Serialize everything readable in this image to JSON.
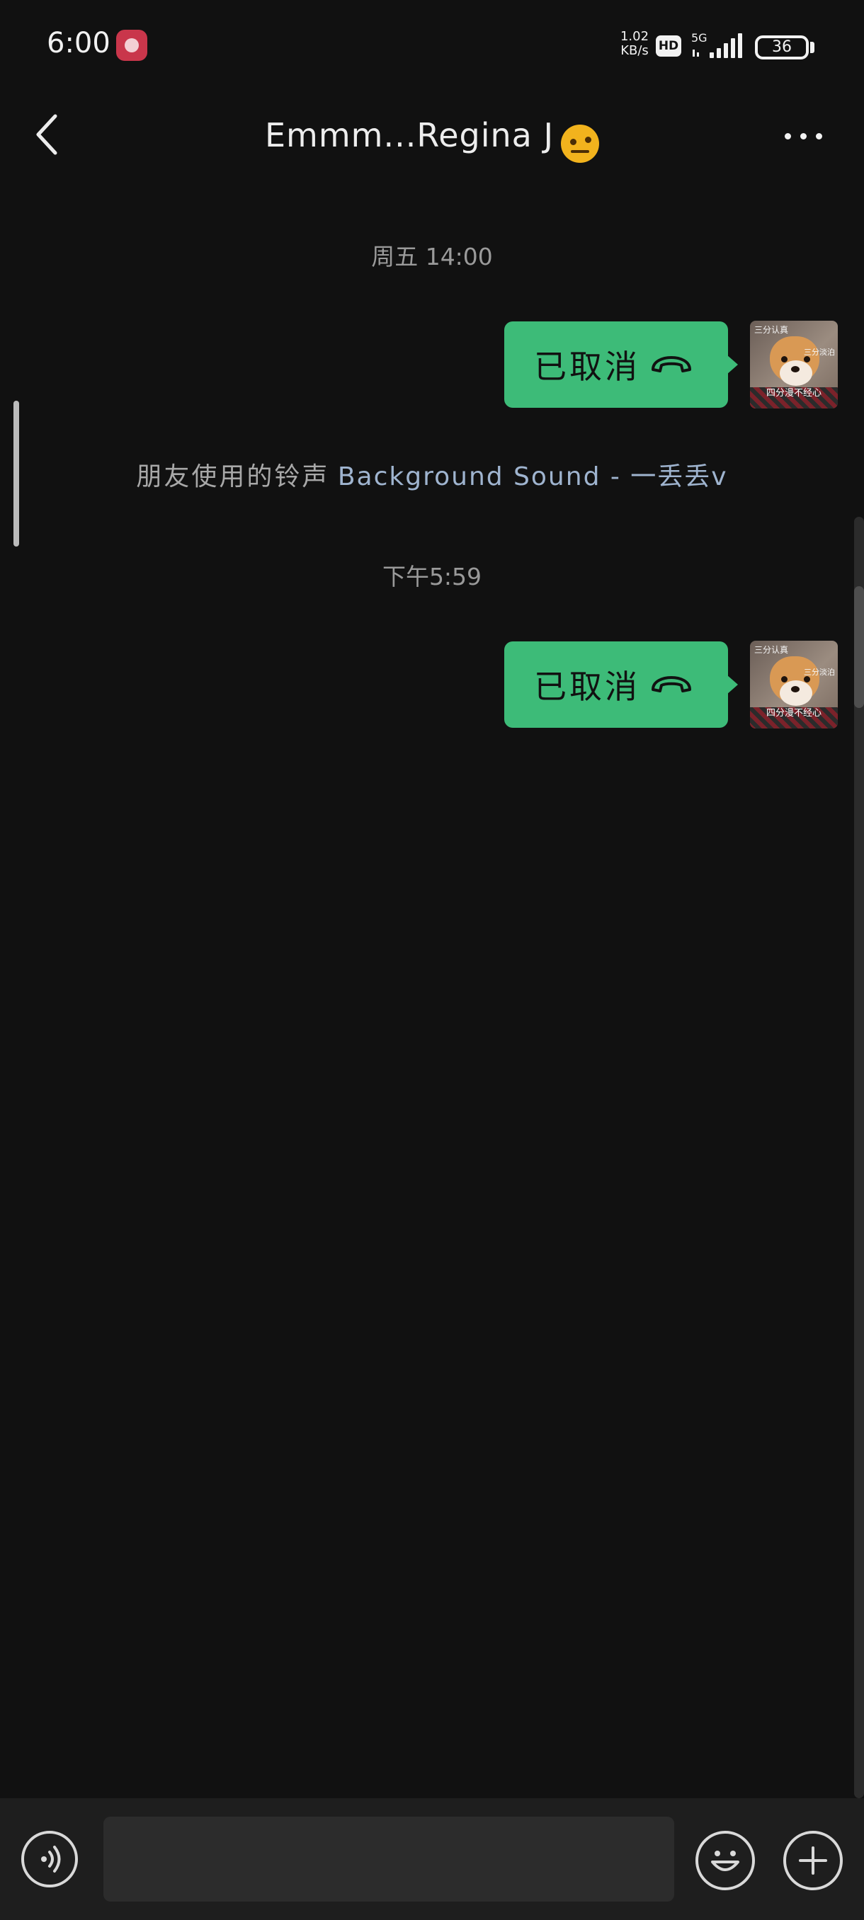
{
  "status_bar": {
    "time": "6:00",
    "net_speed_value": "1.02",
    "net_speed_unit": "KB/s",
    "hd_label": "HD",
    "network_type": "5G",
    "battery_level": "36"
  },
  "header": {
    "title": "Emmm...Regina J",
    "title_emoji_icon": "face-with-raised-eyebrow-emoji",
    "back_icon": "chevron-left-icon",
    "more_icon": "more-dots-icon"
  },
  "messages": [
    {
      "type": "timestamp",
      "text": "周五 14:00"
    },
    {
      "type": "call",
      "text": "已取消",
      "icon": "hangup-phone-icon",
      "sender": "self"
    },
    {
      "type": "ringtone",
      "prefix": "朋友使用的铃声",
      "song": "Background Sound - 一丢丢v"
    },
    {
      "type": "timestamp",
      "text": "下午5:59"
    },
    {
      "type": "call",
      "text": "已取消",
      "icon": "hangup-phone-icon",
      "sender": "self"
    }
  ],
  "avatar": {
    "top_text": "三分认真",
    "mid_text": "三分淡泊",
    "bottom_text": "四分漫不经心"
  },
  "bottom_bar": {
    "input_value": "",
    "voice_icon": "voice-icon",
    "emoji_icon": "smiley-icon",
    "plus_icon": "plus-icon"
  },
  "colors": {
    "background": "#111111",
    "bubble": "#3dbb78",
    "link": "#9fb4cf"
  }
}
